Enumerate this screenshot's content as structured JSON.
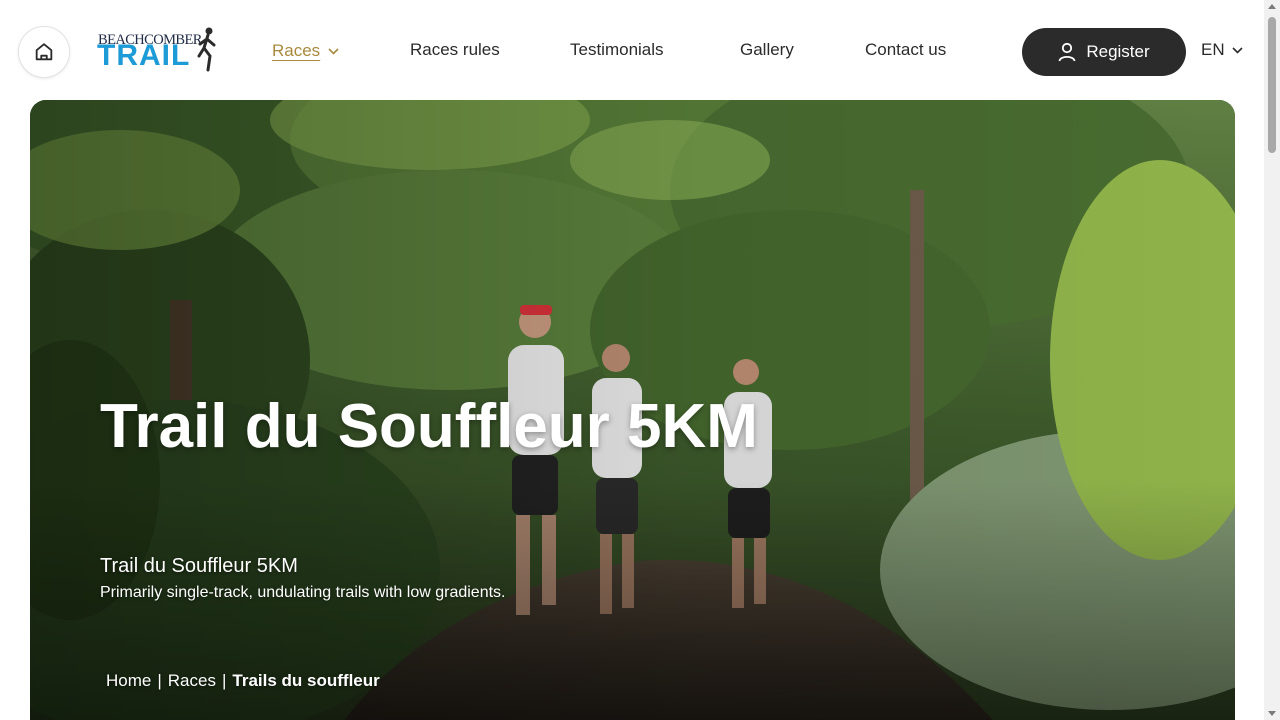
{
  "header": {
    "logo_top": "BEACHCOMBER",
    "logo_bottom": "TRAIL",
    "nav": [
      {
        "label": "Races",
        "active": true,
        "has_dropdown": true
      },
      {
        "label": "Races rules"
      },
      {
        "label": "Testimonials"
      },
      {
        "label": "Gallery"
      },
      {
        "label": "Contact us"
      }
    ],
    "register_label": "Register",
    "language": "EN"
  },
  "hero": {
    "title": "Trail du Souffleur 5KM",
    "subtitle": "Trail du Souffleur 5KM",
    "description": "Primarily single-track, undulating trails with low gradients.",
    "breadcrumb": [
      "Home",
      "Races",
      "Trails du souffleur"
    ]
  },
  "colors": {
    "accent_active": "#a88a3e",
    "logo_blue": "#1d9bd7",
    "button_dark": "#2b2b2b"
  },
  "icons": {
    "home": "home-icon",
    "user": "user-icon",
    "chevron": "chevron-down-icon"
  }
}
